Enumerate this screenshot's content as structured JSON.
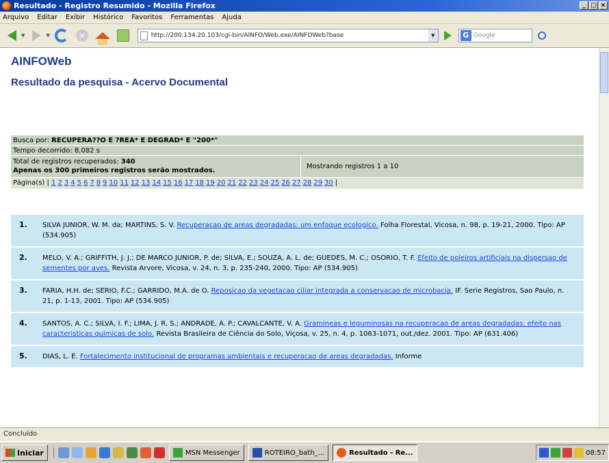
{
  "window": {
    "title": "Resultado - Registro Resumido - Mozilla Firefox"
  },
  "menu": [
    "Arquivo",
    "Editar",
    "Exibir",
    "Histórico",
    "Favoritos",
    "Ferramentas",
    "Ajuda"
  ],
  "toolbar": {
    "url": "http://200.134.20.103/cgi-bin/AINFO/Web.exe/AINFOWeb?base",
    "search_placeholder": "Google"
  },
  "page": {
    "brand": "AINFOWeb",
    "subtitle": "Resultado da pesquisa - Acervo Documental",
    "busca_label": "Busca por:",
    "busca_query": "RECUPERA??O E ?REA* E DEGRAD* E \"200*\"",
    "tempo": "Tempo decorrido: 8,082 s",
    "total_label": "Total de registros recuperados:",
    "total_value": "340",
    "limit_note": "Apenas os 300 primeiros registros serão mostrados.",
    "mostrando": "Mostrando registros 1 a 10",
    "paginas_label": "Página(s) |",
    "pages": [
      "1",
      "2",
      "3",
      "4",
      "5",
      "6",
      "7",
      "8",
      "9",
      "10",
      "11",
      "12",
      "13",
      "14",
      "15",
      "16",
      "17",
      "18",
      "19",
      "20",
      "21",
      "22",
      "23",
      "24",
      "25",
      "26",
      "27",
      "28",
      "29",
      "30"
    ],
    "paginas_end": "|"
  },
  "results": [
    {
      "num": "1.",
      "authors": "SILVA JUNIOR, W. M. da; MARTINS, S. V.",
      "title": "Recuperacao de areas degradadas: um enfoque ecologico.",
      "rest": "Folha Florestal, Vicosa, n. 98, p. 19-21, 2000. Tipo: AP (534.905)"
    },
    {
      "num": "2.",
      "authors": "MELO, V. A.; GRIFFITH, J. J.; DE MARCO JUNIOR, P. de; SILVA, E.; SOUZA, A. L. de; GUEDES, M. C.; OSORIO, T. F.",
      "title": "Efeito de poleiros artificiais na dispersao de sementes por aves.",
      "rest": "Revista Arvore, Vicosa, v. 24, n. 3, p. 235-240, 2000. Tipo: AP (534.905)"
    },
    {
      "num": "3.",
      "authors": "FARIA, H.H. de; SERIO, F.C.; GARRIDO, M.A. de O.",
      "title": "Reposicao da vegetacao ciliar integrada a conservacao de microbacia.",
      "rest": "IF. Serie Registros, Sao Paulo, n. 21, p. 1-13, 2001. Tipo: AP (534.905)"
    },
    {
      "num": "4.",
      "authors": "SANTOS, A. C.; SILVA, I. F.; LIMA, J. R. S.; ANDRADE, A. P.; CAVALCANTE, V. A.",
      "title": "Gramineas e leguminosas na recuperacao de areas degradadas: efeito nas caracteristicas quimicas de solo.",
      "rest": "Revista Brasileira de Ciência do Solo, Viçosa, v. 25, n. 4, p. 1063-1071, out./dez. 2001. Tipo: AP (631.406)"
    },
    {
      "num": "5.",
      "authors": "DIAS, L. E.",
      "title": "Fortalecimento institucional de programas ambientais e recuperacao de areas degradadas.",
      "rest": "Informe"
    }
  ],
  "statusbar": {
    "text": "Concluído"
  },
  "taskbar": {
    "start": "Iniciar",
    "tasks": [
      "MSN Messenger",
      "ROTEIRO_bath_...",
      "Resultado - Re..."
    ],
    "clock": "08:57"
  }
}
